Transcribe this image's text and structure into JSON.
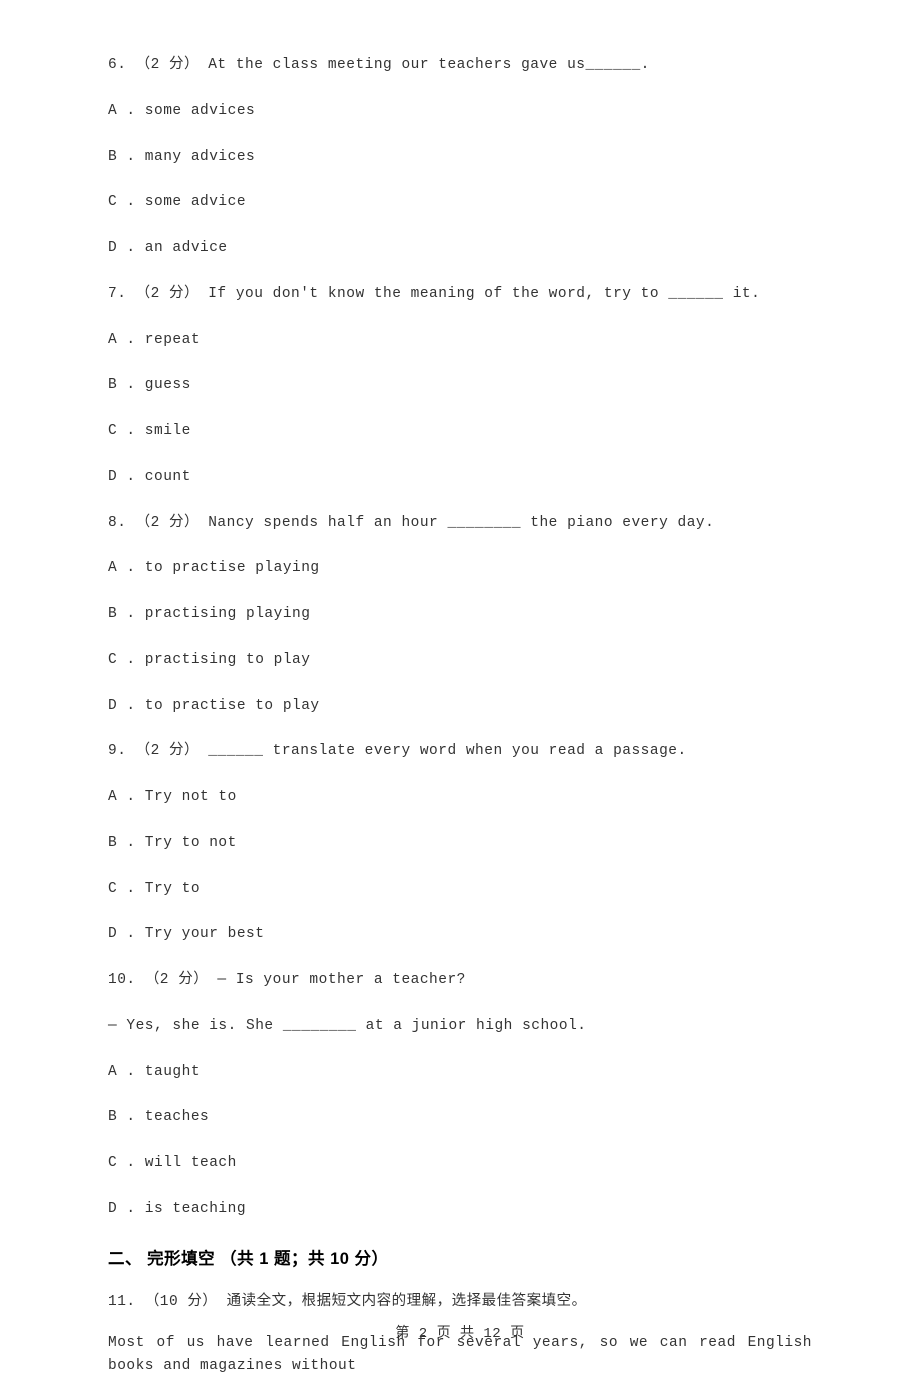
{
  "questions": [
    {
      "num": "6.",
      "pts": "（2 分）",
      "stem": "At the class meeting our teachers gave us______.",
      "opts": {
        "A": "A . some advices",
        "B": "B . many advices",
        "C": "C . some advice",
        "D": "D . an advice"
      }
    },
    {
      "num": "7.",
      "pts": "（2 分）",
      "stem": "If you don't know the meaning of the word, try to ______ it.",
      "opts": {
        "A": "A . repeat",
        "B": "B . guess",
        "C": "C . smile",
        "D": "D . count"
      }
    },
    {
      "num": "8.",
      "pts": "（2 分）",
      "stem": "Nancy spends half an hour ________ the piano every day.",
      "opts": {
        "A": "A . to practise playing",
        "B": "B . practising playing",
        "C": "C . practising to play",
        "D": "D . to practise to play"
      }
    },
    {
      "num": "9.",
      "pts": "（2 分）",
      "stem": "______ translate every word when you read a passage.",
      "opts": {
        "A": "A . Try not to",
        "B": "B . Try to not",
        "C": "C . Try to",
        "D": "D . Try your best"
      }
    },
    {
      "num": "10.",
      "pts": "（2 分）",
      "stem": "— Is your mother a teacher?",
      "stem2": "— Yes, she is. She ________ at a junior high school.",
      "opts": {
        "A": "A . taught",
        "B": "B . teaches",
        "C": "C . will teach",
        "D": "D . is teaching"
      }
    }
  ],
  "section2": {
    "title": "二、 完形填空 （共 1 题；共 10 分）",
    "intro_num": "11.",
    "intro_pts": "（10 分）",
    "intro_text": "通读全文，根据短文内容的理解，选择最佳答案填空。",
    "passage": "Most of us have learned English for several years, so we can read English books and magazines without"
  },
  "footer": "第 2 页 共 12 页"
}
